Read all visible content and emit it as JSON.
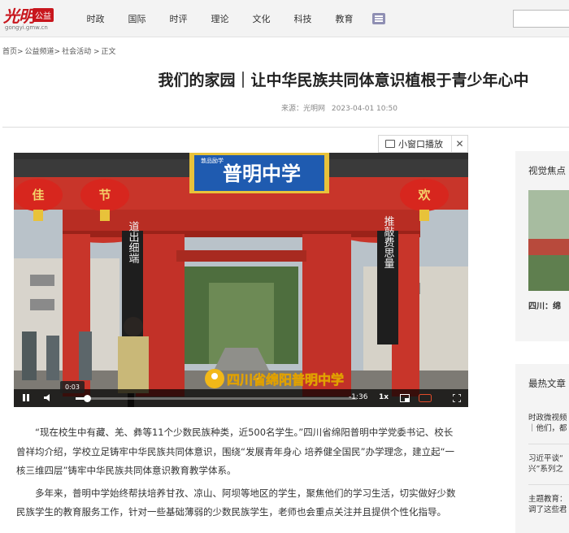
{
  "logo": {
    "main": "光明",
    "badge": "公益",
    "sub": "gongyi.gmw.cn"
  },
  "nav": {
    "items": [
      {
        "label": "时政"
      },
      {
        "label": "国际"
      },
      {
        "label": "时评"
      },
      {
        "label": "理论"
      },
      {
        "label": "文化"
      },
      {
        "label": "科技"
      },
      {
        "label": "教育"
      }
    ]
  },
  "breadcrumb": {
    "home": "首页>",
    "channel": "公益频道>",
    "section": "社会活动 >",
    "current": "正文"
  },
  "article": {
    "title": "我们的家园｜让中华民族共同体意识植根于青少年心中",
    "source": "来源：光明网",
    "date": "2023-04-01 10:50",
    "paragraphs": [
      "“现在校生中有藏、羌、彝等11个少数民族种类，近500名学生。”四川省绵阳普明中学党委书记、校长曾祥均介绍，学校立足铸牢中华民族共同体意识，围绕“发展青年身心 培养健全国民”办学理念，建立起“一核三维四层”铸牢中华民族共同体意识教育教学体系。",
      "多年来，普明中学始终帮扶培养甘孜、凉山、阿坝等地区的学生，聚焦他们的学习生活，切实做好少数民族学生的教育服务工作，针对一些基础薄弱的少数民族学生，老师也会重点关注并且提供个性化指导。"
    ]
  },
  "player": {
    "mini_label": "小窗口播放",
    "close_symbol": "✕",
    "time_tooltip": "0:03",
    "remaining": "-1:36",
    "speed": "1x",
    "progress": 0.04,
    "video_text": {
      "plaque": "普明中学",
      "plaque_side": "敦品励学",
      "location": "四川省绵阳普明中学",
      "lantern_left1": "佳",
      "lantern_left2": "节",
      "lantern_right": "欢",
      "couplet_left": "道出细端",
      "couplet_right": "推敲费思量"
    }
  },
  "sidebar": {
    "focus_title": "视觉焦点",
    "focus_caption": "四川：绵",
    "latest_title": "最热文章",
    "latest_items": [
      {
        "line1": "时政微视频",
        "line2": "｜他们，都"
      },
      {
        "line1": "习近平谈“",
        "line2": "兴”系列之"
      },
      {
        "line1": "主题教育：",
        "line2": "调了这些君"
      }
    ]
  },
  "colors": {
    "brand_red": "#c8161d",
    "gate_red": "#c8352a",
    "plaque_blue": "#1f5bb0",
    "plaque_gold": "#e8c23a"
  }
}
